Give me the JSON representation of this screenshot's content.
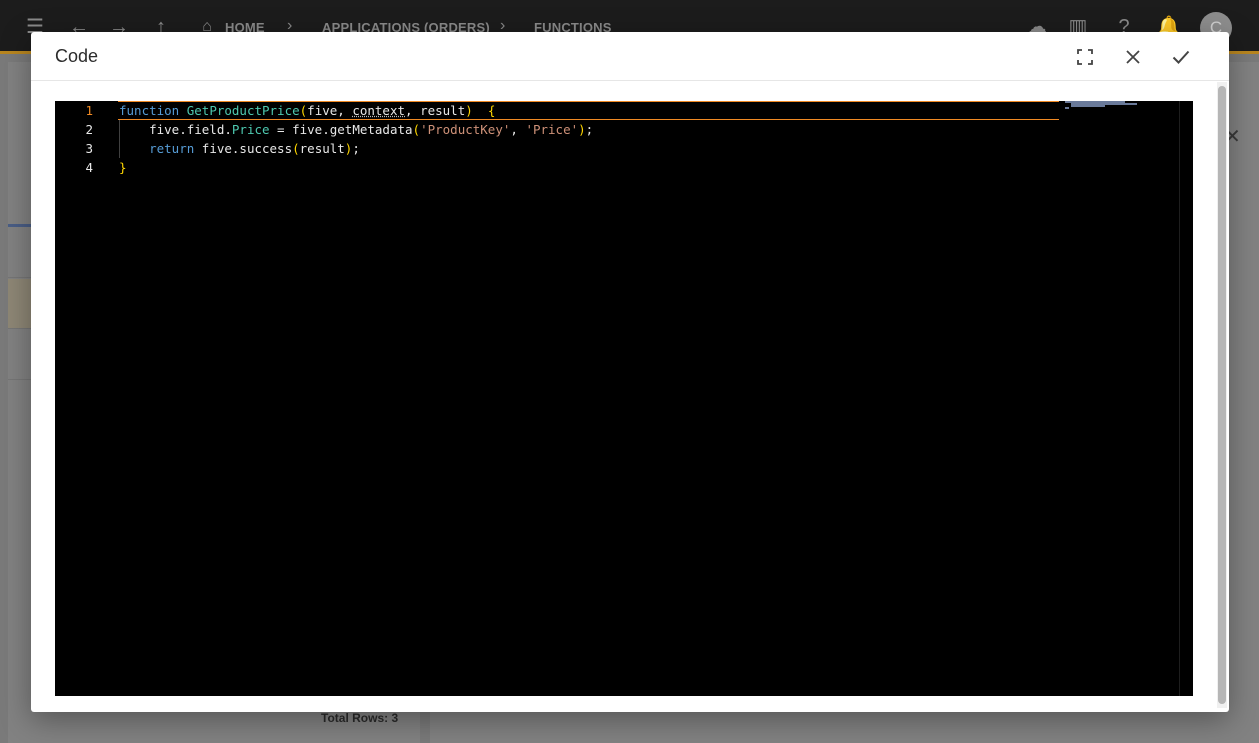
{
  "app": {
    "breadcrumb": [
      "HOME",
      "APPLICATIONS (ORDERS)",
      "FUNCTIONS"
    ],
    "avatar_initial": "C",
    "total_rows_label": "Total Rows: 3"
  },
  "modal": {
    "title": "Code",
    "buttons": {
      "fullscreen": "fullscreen-icon",
      "close": "close-icon",
      "confirm": "check-icon"
    }
  },
  "editor": {
    "line_numbers": [
      "1",
      "2",
      "3",
      "4"
    ],
    "active_line": 1,
    "lines": [
      "function GetProductPrice(five, context, result)  {",
      "    five.field.Price = five.getMetadata('ProductKey', 'Price');",
      "    return five.success(result);",
      "}"
    ],
    "colors": {
      "keyword": "#569cd6",
      "function": "#4ec9b0",
      "string": "#ce9178",
      "brace": "#ffd700",
      "active_line_number": "#f08a24"
    }
  }
}
